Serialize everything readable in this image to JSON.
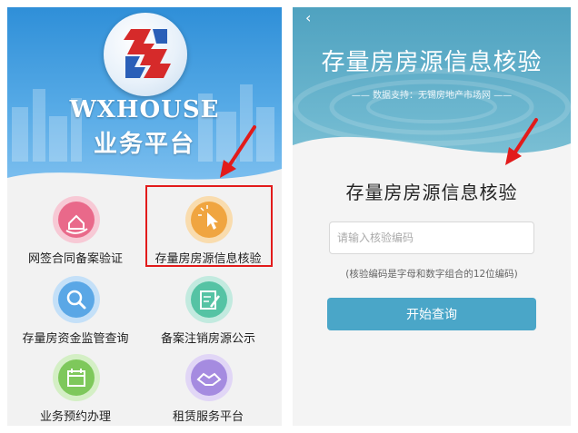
{
  "left": {
    "brand_en": "WXHOUSE",
    "brand_cn": "业务平台",
    "menu": [
      {
        "label": "网签合同备案验证",
        "icon": "hand-house-icon",
        "color": "#e9698a"
      },
      {
        "label": "存量房房源信息核验",
        "icon": "click-pointer-icon",
        "color": "#f0a540"
      },
      {
        "label": "存量房资金监管查询",
        "icon": "magnifier-icon",
        "color": "#5aa7e6"
      },
      {
        "label": "备案注销房源公示",
        "icon": "edit-document-icon",
        "color": "#55c3a4"
      },
      {
        "label": "业务预约办理",
        "icon": "calendar-icon",
        "color": "#7ec85b"
      },
      {
        "label": "租赁服务平台",
        "icon": "handshake-icon",
        "color": "#a58be0"
      }
    ]
  },
  "right": {
    "title": "存量房房源信息核验",
    "subtitle": "—— 数据支持：无锡房地产市场网 ——",
    "heading": "存量房房源信息核验",
    "input_placeholder": "请输入核验编码",
    "hint": "(核验编码是字母和数字组合的12位编码)",
    "button_label": "开始查询"
  },
  "colors": {
    "left_header": "#3a95dc",
    "right_header": "#5aaec7",
    "button": "#4aa6c8",
    "highlight": "#e21b1b"
  }
}
